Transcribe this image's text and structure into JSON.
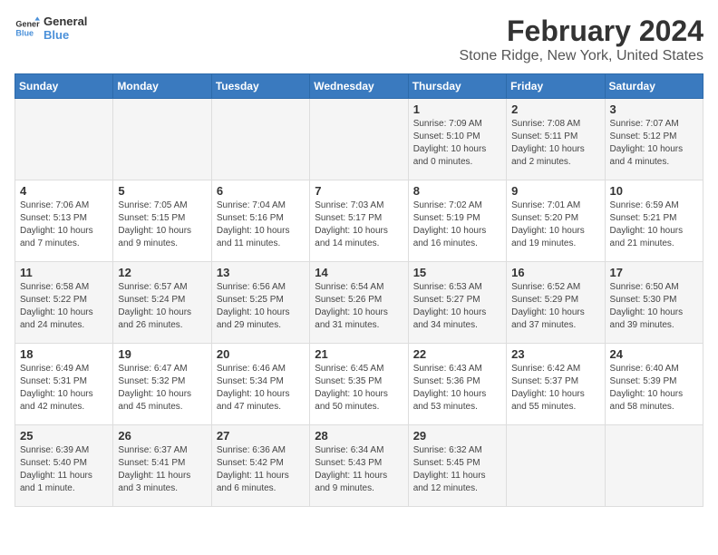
{
  "logo": {
    "text_general": "General",
    "text_blue": "Blue"
  },
  "header": {
    "title": "February 2024",
    "subtitle": "Stone Ridge, New York, United States"
  },
  "weekdays": [
    "Sunday",
    "Monday",
    "Tuesday",
    "Wednesday",
    "Thursday",
    "Friday",
    "Saturday"
  ],
  "weeks": [
    [
      {
        "day": "",
        "info": ""
      },
      {
        "day": "",
        "info": ""
      },
      {
        "day": "",
        "info": ""
      },
      {
        "day": "",
        "info": ""
      },
      {
        "day": "1",
        "info": "Sunrise: 7:09 AM\nSunset: 5:10 PM\nDaylight: 10 hours\nand 0 minutes."
      },
      {
        "day": "2",
        "info": "Sunrise: 7:08 AM\nSunset: 5:11 PM\nDaylight: 10 hours\nand 2 minutes."
      },
      {
        "day": "3",
        "info": "Sunrise: 7:07 AM\nSunset: 5:12 PM\nDaylight: 10 hours\nand 4 minutes."
      }
    ],
    [
      {
        "day": "4",
        "info": "Sunrise: 7:06 AM\nSunset: 5:13 PM\nDaylight: 10 hours\nand 7 minutes."
      },
      {
        "day": "5",
        "info": "Sunrise: 7:05 AM\nSunset: 5:15 PM\nDaylight: 10 hours\nand 9 minutes."
      },
      {
        "day": "6",
        "info": "Sunrise: 7:04 AM\nSunset: 5:16 PM\nDaylight: 10 hours\nand 11 minutes."
      },
      {
        "day": "7",
        "info": "Sunrise: 7:03 AM\nSunset: 5:17 PM\nDaylight: 10 hours\nand 14 minutes."
      },
      {
        "day": "8",
        "info": "Sunrise: 7:02 AM\nSunset: 5:19 PM\nDaylight: 10 hours\nand 16 minutes."
      },
      {
        "day": "9",
        "info": "Sunrise: 7:01 AM\nSunset: 5:20 PM\nDaylight: 10 hours\nand 19 minutes."
      },
      {
        "day": "10",
        "info": "Sunrise: 6:59 AM\nSunset: 5:21 PM\nDaylight: 10 hours\nand 21 minutes."
      }
    ],
    [
      {
        "day": "11",
        "info": "Sunrise: 6:58 AM\nSunset: 5:22 PM\nDaylight: 10 hours\nand 24 minutes."
      },
      {
        "day": "12",
        "info": "Sunrise: 6:57 AM\nSunset: 5:24 PM\nDaylight: 10 hours\nand 26 minutes."
      },
      {
        "day": "13",
        "info": "Sunrise: 6:56 AM\nSunset: 5:25 PM\nDaylight: 10 hours\nand 29 minutes."
      },
      {
        "day": "14",
        "info": "Sunrise: 6:54 AM\nSunset: 5:26 PM\nDaylight: 10 hours\nand 31 minutes."
      },
      {
        "day": "15",
        "info": "Sunrise: 6:53 AM\nSunset: 5:27 PM\nDaylight: 10 hours\nand 34 minutes."
      },
      {
        "day": "16",
        "info": "Sunrise: 6:52 AM\nSunset: 5:29 PM\nDaylight: 10 hours\nand 37 minutes."
      },
      {
        "day": "17",
        "info": "Sunrise: 6:50 AM\nSunset: 5:30 PM\nDaylight: 10 hours\nand 39 minutes."
      }
    ],
    [
      {
        "day": "18",
        "info": "Sunrise: 6:49 AM\nSunset: 5:31 PM\nDaylight: 10 hours\nand 42 minutes."
      },
      {
        "day": "19",
        "info": "Sunrise: 6:47 AM\nSunset: 5:32 PM\nDaylight: 10 hours\nand 45 minutes."
      },
      {
        "day": "20",
        "info": "Sunrise: 6:46 AM\nSunset: 5:34 PM\nDaylight: 10 hours\nand 47 minutes."
      },
      {
        "day": "21",
        "info": "Sunrise: 6:45 AM\nSunset: 5:35 PM\nDaylight: 10 hours\nand 50 minutes."
      },
      {
        "day": "22",
        "info": "Sunrise: 6:43 AM\nSunset: 5:36 PM\nDaylight: 10 hours\nand 53 minutes."
      },
      {
        "day": "23",
        "info": "Sunrise: 6:42 AM\nSunset: 5:37 PM\nDaylight: 10 hours\nand 55 minutes."
      },
      {
        "day": "24",
        "info": "Sunrise: 6:40 AM\nSunset: 5:39 PM\nDaylight: 10 hours\nand 58 minutes."
      }
    ],
    [
      {
        "day": "25",
        "info": "Sunrise: 6:39 AM\nSunset: 5:40 PM\nDaylight: 11 hours\nand 1 minute."
      },
      {
        "day": "26",
        "info": "Sunrise: 6:37 AM\nSunset: 5:41 PM\nDaylight: 11 hours\nand 3 minutes."
      },
      {
        "day": "27",
        "info": "Sunrise: 6:36 AM\nSunset: 5:42 PM\nDaylight: 11 hours\nand 6 minutes."
      },
      {
        "day": "28",
        "info": "Sunrise: 6:34 AM\nSunset: 5:43 PM\nDaylight: 11 hours\nand 9 minutes."
      },
      {
        "day": "29",
        "info": "Sunrise: 6:32 AM\nSunset: 5:45 PM\nDaylight: 11 hours\nand 12 minutes."
      },
      {
        "day": "",
        "info": ""
      },
      {
        "day": "",
        "info": ""
      }
    ]
  ]
}
